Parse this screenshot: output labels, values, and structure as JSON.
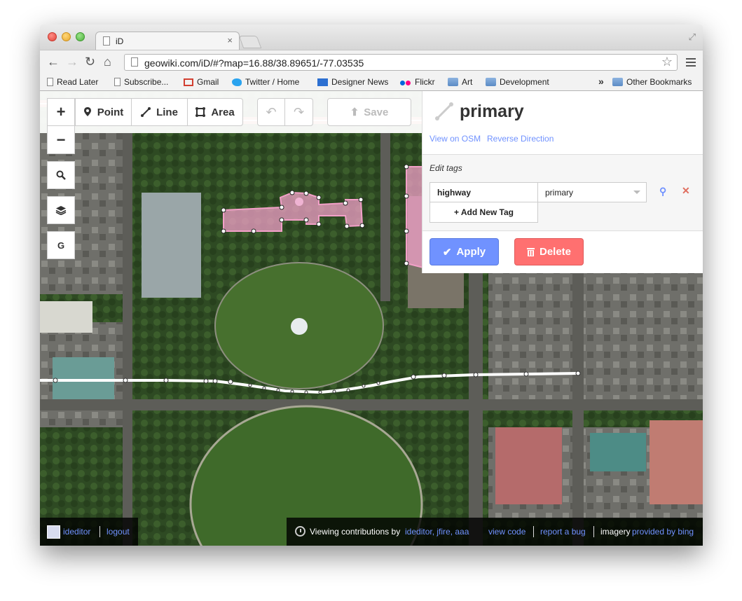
{
  "browser": {
    "tab_title": "iD",
    "tab_close": "×",
    "url": "geowiki.com/iD/#?map=16.88/38.89651/-77.03535",
    "bookmarks": [
      {
        "label": "Read Later",
        "icon": "doc-icon"
      },
      {
        "label": "Subscribe...",
        "icon": "doc-icon"
      },
      {
        "label": "Gmail",
        "icon": "gmail-icon"
      },
      {
        "label": "Twitter / Home",
        "icon": "twitter-icon"
      },
      {
        "label": "Designer News",
        "icon": "designer-news-icon"
      },
      {
        "label": "Flickr",
        "icon": "flickr-icon"
      },
      {
        "label": "Art",
        "icon": "folder-icon"
      },
      {
        "label": "Development",
        "icon": "folder-icon"
      }
    ],
    "overflow_chevron": "»",
    "other_bookmarks": "Other Bookmarks"
  },
  "editor": {
    "modes": [
      {
        "label": "",
        "icon": "hand-icon",
        "active": true
      },
      {
        "label": "Point",
        "icon": "point-icon",
        "active": false
      },
      {
        "label": "Line",
        "icon": "line-icon",
        "active": false
      },
      {
        "label": "Area",
        "icon": "area-icon",
        "active": false
      }
    ],
    "undo_icon": "undo-icon",
    "redo_icon": "redo-icon",
    "save_label": "Save",
    "map_controls": {
      "zoom_in": "+",
      "zoom_out": "−",
      "geocoder_icon": "search-icon",
      "layers_icon": "layers-icon",
      "geolocate": "G"
    }
  },
  "inspector": {
    "title": "primary",
    "icon": "line-icon",
    "view_on_osm": "View on OSM",
    "reverse_direction": "Reverse Direction",
    "edit_tags_label": "Edit tags",
    "tags": [
      {
        "key": "highway",
        "value": "primary"
      }
    ],
    "add_tag_label": "+ Add New Tag",
    "apply_label": "Apply",
    "delete_label": "Delete"
  },
  "footer": {
    "user": "ideditor",
    "logout": "logout",
    "viewing_prefix": "Viewing contributions by",
    "contributors": "ideditor, jfire, aaa",
    "view_code": "view code",
    "report_bug": "report a bug",
    "imagery_prefix": "imagery",
    "imagery_source": "provided by bing"
  },
  "colors": {
    "accent_blue": "#7092ff",
    "delete_red": "#ff7070",
    "area_pink": "#f2a0c8",
    "selected_road": "#ff5a5a"
  }
}
